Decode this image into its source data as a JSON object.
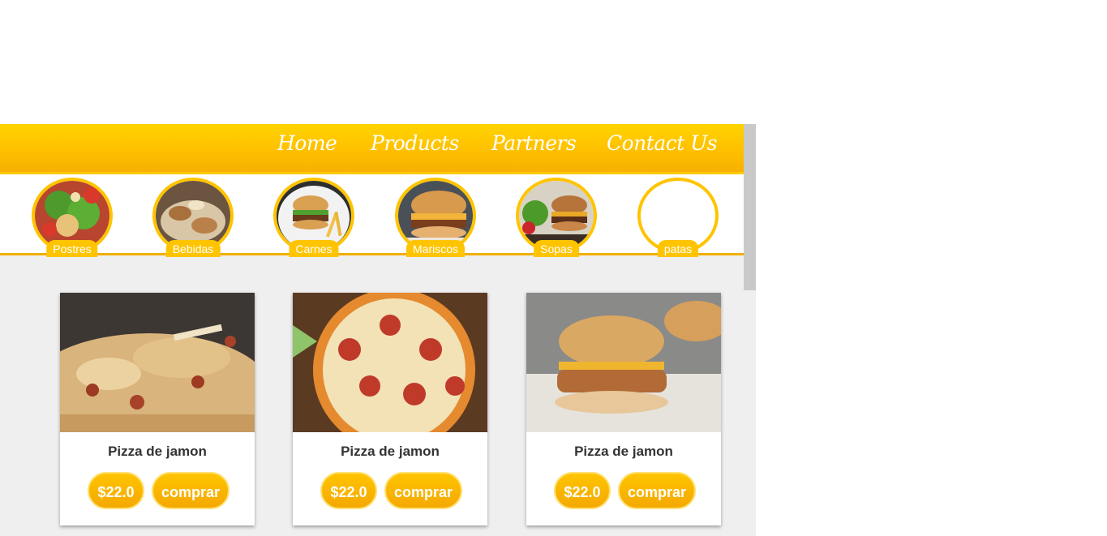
{
  "nav": {
    "items": [
      {
        "label": "Home"
      },
      {
        "label": "Products"
      },
      {
        "label": "Partners"
      },
      {
        "label": "Contact Us"
      }
    ]
  },
  "categories": [
    {
      "label": "Postres",
      "icon": "salad-pizza-photo"
    },
    {
      "label": "Bebidas",
      "icon": "chicken-dish-photo"
    },
    {
      "label": "Carnes",
      "icon": "burger-fries-photo"
    },
    {
      "label": "Mariscos",
      "icon": "burger-photo"
    },
    {
      "label": "Sopas",
      "icon": "burger-salad-photo"
    },
    {
      "label": "patas",
      "icon": "empty-image"
    }
  ],
  "products": [
    {
      "title": "Pizza de jamon",
      "price": "$22.0",
      "buy_label": "comprar"
    },
    {
      "title": "Pizza de jamon",
      "price": "$22.0",
      "buy_label": "comprar"
    },
    {
      "title": "Pizza de jamon",
      "price": "$22.0",
      "buy_label": "comprar"
    }
  ],
  "colors": {
    "accent": "#ffc400",
    "nav_top": "#ffd400",
    "background": "#efefef"
  }
}
